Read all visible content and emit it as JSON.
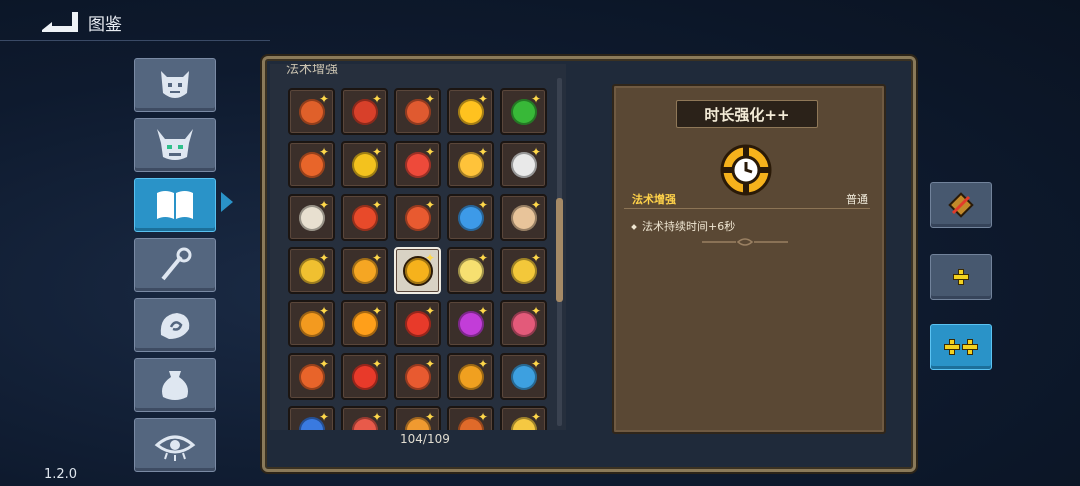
{
  "header": {
    "title": "图鉴"
  },
  "version": "1.2.0",
  "categories": [
    {
      "name": "monsters",
      "icon": "devil-face-icon",
      "active": false
    },
    {
      "name": "bosses",
      "icon": "horned-skull-icon",
      "active": false
    },
    {
      "name": "codex",
      "icon": "open-book-icon",
      "active": true
    },
    {
      "name": "staffs",
      "icon": "staff-icon",
      "active": false
    },
    {
      "name": "spells",
      "icon": "swirl-hand-icon",
      "active": false
    },
    {
      "name": "items",
      "icon": "pouch-icon",
      "active": false
    },
    {
      "name": "curses",
      "icon": "eye-icon",
      "active": false
    }
  ],
  "grid": {
    "header": "法术增强",
    "count": "104/109",
    "cells": [
      "#e0602a",
      "#d8402a",
      "#e05a30",
      "#ffc21f",
      "#38b838",
      "#e8652a",
      "#f3c21e",
      "#ee4a3a",
      "#ffc33a",
      "#e9e9e9",
      "#e8e0d0",
      "#e84a2a",
      "#e85a30",
      "#3d9ae8",
      "#e8c49a",
      "#f0c030",
      "#f5a623",
      "#ffffff",
      "#f6e070",
      "#f3c83a",
      "#f39a1f",
      "#ff9f1a",
      "#e83a2a",
      "#c23dd8",
      "#e35a7a",
      "#e8642a",
      "#e83a2a",
      "#e85a30",
      "#f0a020",
      "#3da0e0",
      "#3a7ae0",
      "#e85a4a",
      "#f09a30",
      "#e06a2a",
      "#f5c842"
    ],
    "selected_index": 17
  },
  "detail": {
    "title": "时长强化++",
    "category": "法术增强",
    "rarity": "普通",
    "description": "法术持续时间+6秒",
    "icon": "stopwatch-target-icon"
  },
  "tiers": [
    {
      "label": "base",
      "plus_count": 0,
      "active": false
    },
    {
      "label": "+",
      "plus_count": 1,
      "active": false
    },
    {
      "label": "++",
      "plus_count": 2,
      "active": true
    }
  ],
  "colors": {
    "accent": "#2a93c8",
    "gold": "#ffd24a",
    "panel": "#5a4834"
  }
}
